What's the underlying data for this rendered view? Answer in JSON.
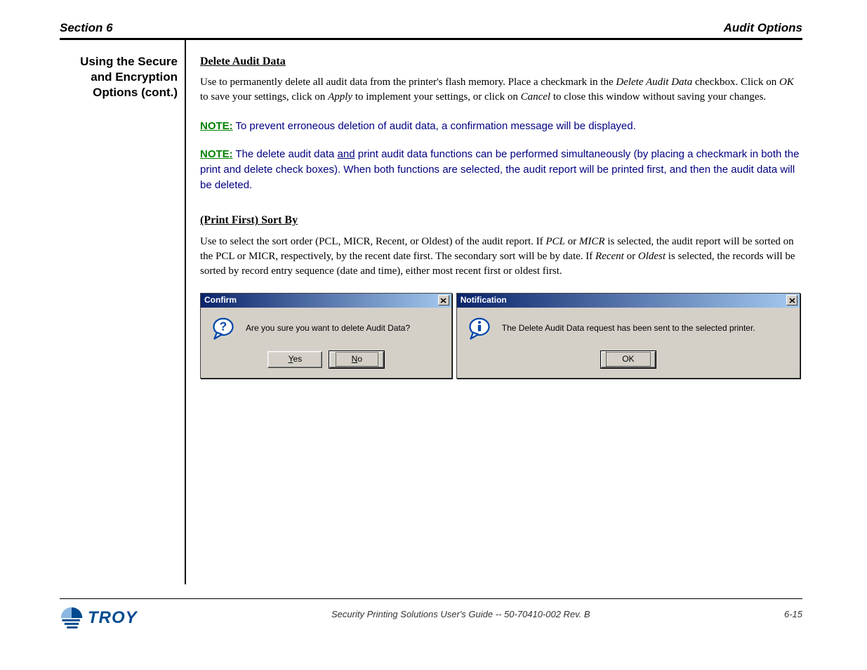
{
  "header": {
    "left": "Section 6",
    "right": "Audit Options"
  },
  "sidebar_title": "Using the Secure and Encryption Options (cont.)",
  "delete": {
    "heading": "Delete Audit Data",
    "para": "Use to permanently delete all audit data from the printer's flash memory. Place a checkmark in the Delete Audit Data checkbox. Click on OK to save your settings, click on Apply to implement your settings, or click on Cancel to close this window without saving your changes."
  },
  "notes": [
    {
      "label": "NOTE:",
      "text": "To prevent erroneous deletion of audit data, a confirmation message will be displayed."
    },
    {
      "label": "NOTE:",
      "text": "The delete audit data and print audit data functions can be performed simultaneously (by placing a checkmark in both the print and delete check boxes). When both functions are selected, the audit report will be printed first, and then the audit data will be deleted."
    }
  ],
  "underline_word": "and",
  "print_first": {
    "heading": "(Print First) Sort By",
    "para": "Use to select the sort order (PCL, MICR, Recent, or Oldest) of the audit report. If PCL or MICR is selected, the audit report will be sorted on the PCL or MICR, respectively, by the recent date first. The secondary sort will be by date. If Recent or Oldest is selected, the records will be sorted by record entry sequence (date and time), either most recent first or oldest first."
  },
  "dialogs": {
    "confirm": {
      "title": "Confirm",
      "message": "Are you sure you want to delete Audit Data?",
      "yes_mnemonic": "Y",
      "yes_rest": "es",
      "no_mnemonic": "N",
      "no_rest": "o"
    },
    "notify": {
      "title": "Notification",
      "message": "The Delete Audit Data request has been sent to the selected printer.",
      "ok": "OK"
    }
  },
  "footer": {
    "mid": "Security Printing Solutions User's Guide -- 50-70410-002 Rev. B",
    "right": "6-15"
  },
  "logo_text": "TROY"
}
